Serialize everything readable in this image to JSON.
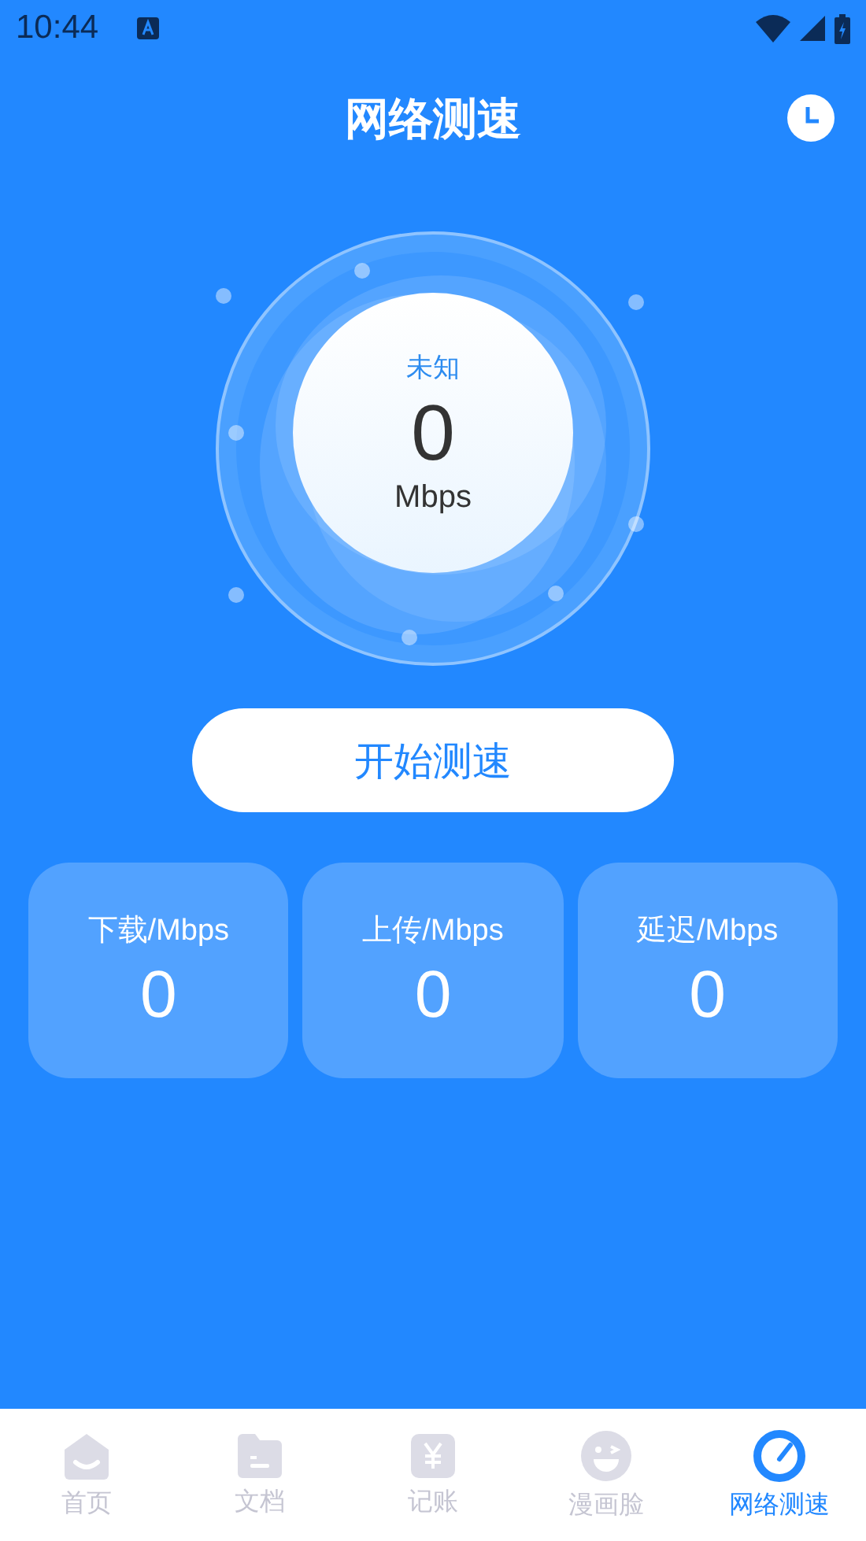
{
  "status_bar": {
    "time": "10:44"
  },
  "header": {
    "title": "网络测速"
  },
  "gauge": {
    "status": "未知",
    "value": "0",
    "unit": "Mbps"
  },
  "start_button": {
    "label": "开始测速"
  },
  "stats": [
    {
      "label": "下载/Mbps",
      "value": "0"
    },
    {
      "label": "上传/Mbps",
      "value": "0"
    },
    {
      "label": "延迟/Mbps",
      "value": "0"
    }
  ],
  "tabs": [
    {
      "label": "首页",
      "kind": "home",
      "selected": false
    },
    {
      "label": "文档",
      "kind": "docs",
      "selected": false
    },
    {
      "label": "记账",
      "kind": "ledger",
      "selected": false
    },
    {
      "label": "漫画脸",
      "kind": "face",
      "selected": false
    },
    {
      "label": "网络测速",
      "kind": "speed",
      "selected": true
    }
  ]
}
